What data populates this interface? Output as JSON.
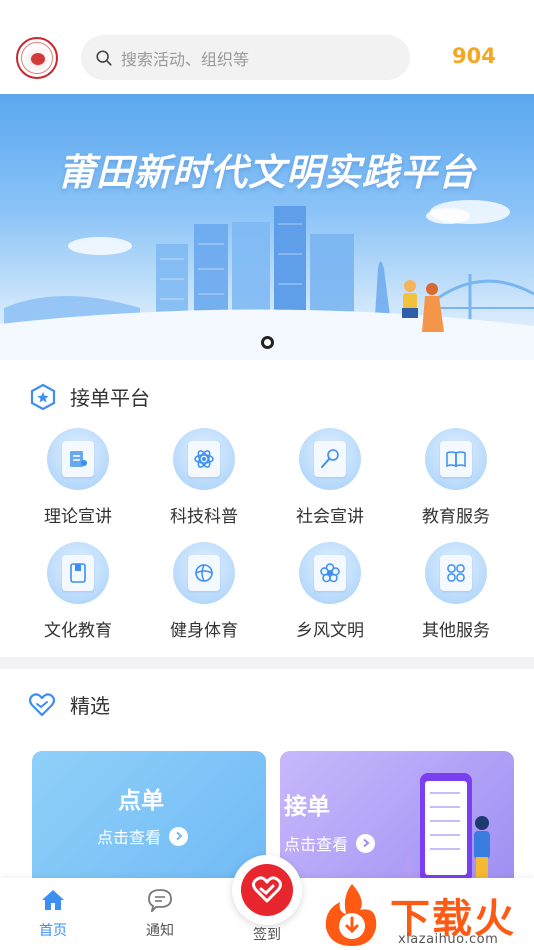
{
  "header": {
    "search_placeholder": "搜索活动、组织等",
    "count": "904"
  },
  "banner": {
    "title": "莆田新时代文明实践平台"
  },
  "order_platform": {
    "title": "接单平台",
    "items": [
      {
        "label": "理论宣讲",
        "icon": "document-person-icon"
      },
      {
        "label": "科技科普",
        "icon": "atom-icon"
      },
      {
        "label": "社会宣讲",
        "icon": "microphone-icon"
      },
      {
        "label": "教育服务",
        "icon": "book-icon"
      },
      {
        "label": "文化教育",
        "icon": "notebook-icon"
      },
      {
        "label": "健身体育",
        "icon": "ball-icon"
      },
      {
        "label": "乡风文明",
        "icon": "flower-icon"
      },
      {
        "label": "其他服务",
        "icon": "grid-icon"
      }
    ]
  },
  "featured": {
    "title": "精选",
    "cards": [
      {
        "title": "点单",
        "link": "点击查看"
      },
      {
        "title": "接单",
        "link": "点击查看"
      }
    ]
  },
  "bottom_nav": {
    "items": [
      {
        "label": "首页",
        "active": true
      },
      {
        "label": "通知",
        "active": false
      },
      {
        "label": "签到",
        "active": false
      }
    ]
  },
  "watermark": {
    "text": "下载火",
    "url": "xiazaihuo.com"
  },
  "colors": {
    "accent_blue": "#4a90e2",
    "count_orange": "#f5a623",
    "fab_red": "#e8262e",
    "nav_active": "#3b8ff3"
  }
}
